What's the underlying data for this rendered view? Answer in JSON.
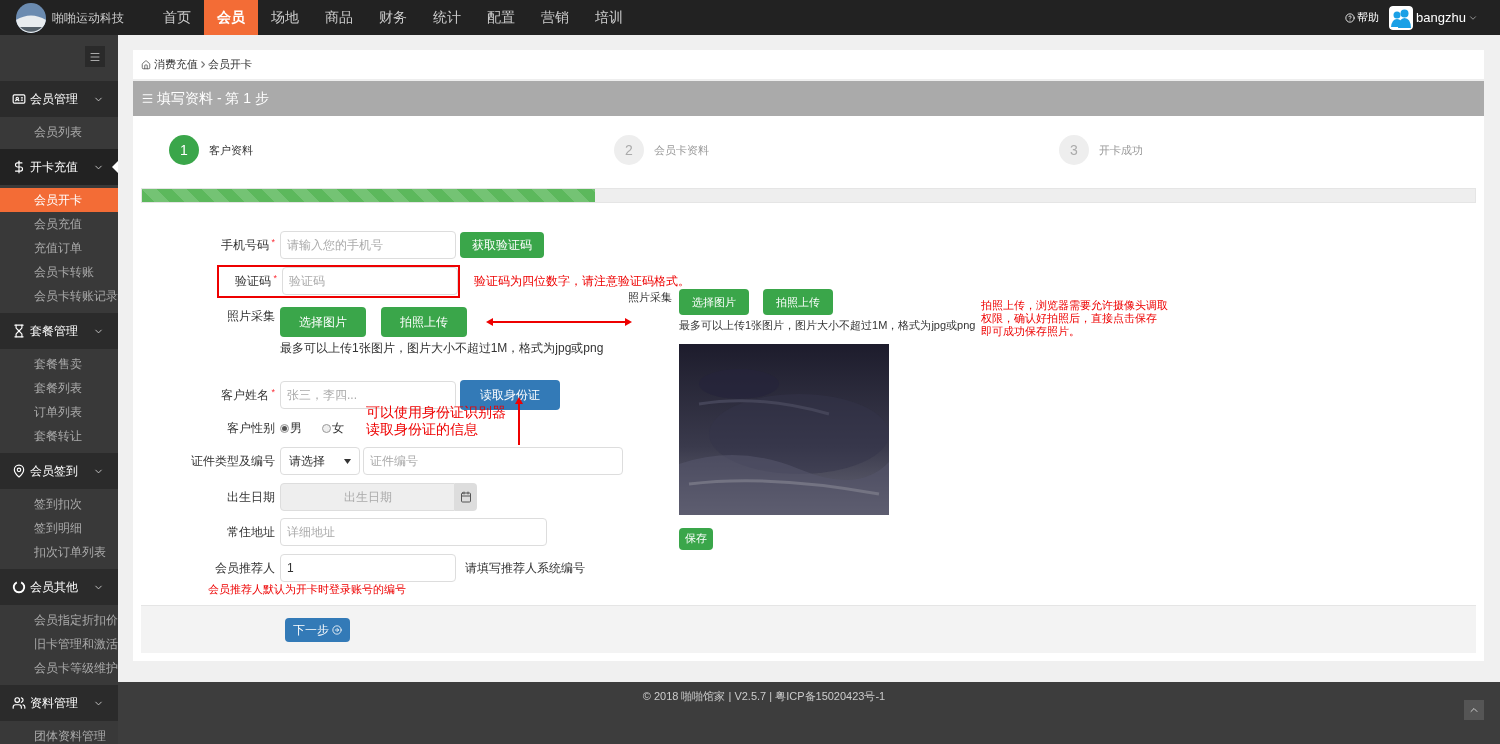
{
  "brand": {
    "name": "啪啪运动科技"
  },
  "nav": [
    {
      "label": "首页",
      "selected": false
    },
    {
      "label": "会员",
      "selected": true
    },
    {
      "label": "场地",
      "selected": false
    },
    {
      "label": "商品",
      "selected": false
    },
    {
      "label": "财务",
      "selected": false
    },
    {
      "label": "统计",
      "selected": false
    },
    {
      "label": "配置",
      "selected": false
    },
    {
      "label": "营销",
      "selected": false
    },
    {
      "label": "培训",
      "selected": false
    }
  ],
  "help": "帮助",
  "user": "bangzhu",
  "sidebar": [
    {
      "label": "会员管理",
      "selected": false,
      "items": [
        {
          "label": "会员列表",
          "selected": false
        }
      ]
    },
    {
      "label": "开卡充值",
      "selected": true,
      "items": [
        {
          "label": "会员开卡",
          "selected": true
        },
        {
          "label": "会员充值",
          "selected": false
        },
        {
          "label": "充值订单",
          "selected": false
        },
        {
          "label": "会员卡转账",
          "selected": false
        },
        {
          "label": "会员卡转账记录",
          "selected": false
        }
      ]
    },
    {
      "label": "套餐管理",
      "selected": false,
      "items": [
        {
          "label": "套餐售卖",
          "selected": false
        },
        {
          "label": "套餐列表",
          "selected": false
        },
        {
          "label": "订单列表",
          "selected": false
        },
        {
          "label": "套餐转让",
          "selected": false
        }
      ]
    },
    {
      "label": "会员签到",
      "selected": false,
      "items": [
        {
          "label": "签到扣次",
          "selected": false
        },
        {
          "label": "签到明细",
          "selected": false
        },
        {
          "label": "扣次订单列表",
          "selected": false
        }
      ]
    },
    {
      "label": "会员其他",
      "selected": false,
      "items": [
        {
          "label": "会员指定折扣价",
          "selected": false
        },
        {
          "label": "旧卡管理和激活",
          "selected": false
        },
        {
          "label": "会员卡等级维护",
          "selected": false
        }
      ]
    },
    {
      "label": "资料管理",
      "selected": false,
      "items": [
        {
          "label": "团体资料管理",
          "selected": false
        }
      ]
    }
  ],
  "breadcrumb": [
    "消费充值",
    "会员开卡"
  ],
  "panel_title": "填写资料 - 第 1 步",
  "steps": [
    {
      "number": "1",
      "label": "客户资料",
      "selected": true
    },
    {
      "number": "2",
      "label": "会员卡资料",
      "selected": false
    },
    {
      "number": "3",
      "label": "开卡成功",
      "selected": false
    }
  ],
  "progress": {
    "level": 0.34
  },
  "rows": [
    {
      "kind": "text",
      "label": "手机号码",
      "required": "*",
      "placeholder": "请输入您的手机号",
      "button": {
        "label": "获取验证码",
        "kind": "success"
      }
    },
    {
      "kind": "text",
      "label": "验证码",
      "required": "*",
      "placeholder": "验证码",
      "highlighted": true,
      "note": "验证码为四位数字，请注意验证码格式。"
    },
    {
      "label": "照片采集",
      "buttons": [
        "选择图片",
        "拍照上传"
      ],
      "hint": "最多可以上传1张图片，图片大小不超过1M，格式为jpg或png"
    },
    {
      "kind": "text",
      "label": "客户姓名",
      "required": "*",
      "placeholder": "张三，李四...",
      "button": {
        "label": "读取身份证",
        "kind": "primary"
      }
    },
    {
      "kind": "radio",
      "label": "客户性别",
      "options": [
        {
          "label": "男",
          "selected": true
        },
        {
          "label": "女",
          "selected": false
        }
      ],
      "note": [
        "可以使用身份证识别器",
        "读取身份证的信息"
      ]
    },
    {
      "kind": "id",
      "label": "证件类型及编号",
      "select": "请选择",
      "placeholder": "证件编号"
    },
    {
      "kind": "date",
      "label": "出生日期",
      "placeholder": "出生日期"
    },
    {
      "kind": "address",
      "label": "常住地址",
      "placeholder": "详细地址"
    },
    {
      "kind": "text",
      "label": "会员推荐人",
      "value": "1",
      "hint": "请填写推荐人系统编号",
      "note_below": "会员推荐人默认为开卡时登录账号的编号"
    }
  ],
  "camera": {
    "label": "照片采集",
    "buttons": [
      "选择图片",
      "拍照上传"
    ],
    "hint": "最多可以上传1张图片，图片大小不超过1M，格式为jpg或png",
    "note": [
      "拍照上传，浏览器需要允许摄像头调取",
      "权限，确认好拍照后，直接点击保存",
      "即可成功保存照片。"
    ],
    "save": "保存"
  },
  "next_button": "下一步",
  "footer": "© 2018 啪啪馆家 | V2.5.7 | 粤ICP备15020423号-1"
}
